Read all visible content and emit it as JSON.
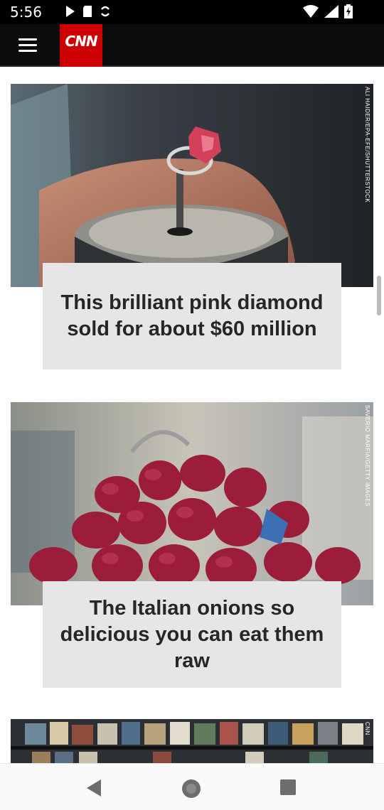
{
  "status_bar": {
    "time": "5:56"
  },
  "app": {
    "logo_text": "CNN",
    "brand_color": "#cc0000"
  },
  "stories": [
    {
      "headline": "This brilliant pink diamond sold for about $60 million",
      "photo_credit": "ALI HAIDER/EPA-EFE/SHUTTERSTOCK"
    },
    {
      "headline": "The Italian onions so delicious you can eat them raw",
      "photo_credit": "SAVERIO MARFIA/GETTY IMAGES"
    },
    {
      "photo_credit": "CNN"
    }
  ]
}
